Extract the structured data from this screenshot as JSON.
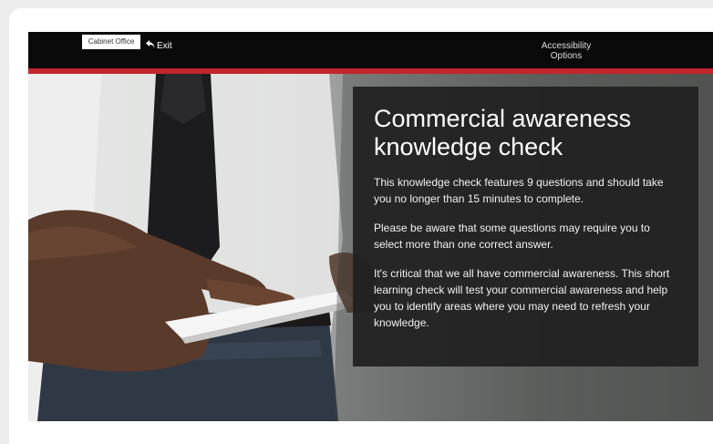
{
  "header": {
    "logo_text": "Cabinet Office",
    "exit_label": "Exit",
    "accessibility_label": "Accessibility Options"
  },
  "content": {
    "title": "Commercial awareness knowledge check",
    "paragraphs": [
      "This knowledge check features 9 questions and should take you no longer than 15 minutes to complete.",
      "Please be aware that some questions may require you to select more than one correct answer.",
      "It's critical that we all have commercial awareness. This short learning check will test your commercial awareness and help you to identify areas where you may need to refresh your knowledge."
    ]
  },
  "colors": {
    "topbar": "#0a0a0a",
    "accent_red": "#c0262d",
    "panel_bg": "#202020"
  },
  "icons": {
    "exit": "exit-arrow-icon"
  }
}
